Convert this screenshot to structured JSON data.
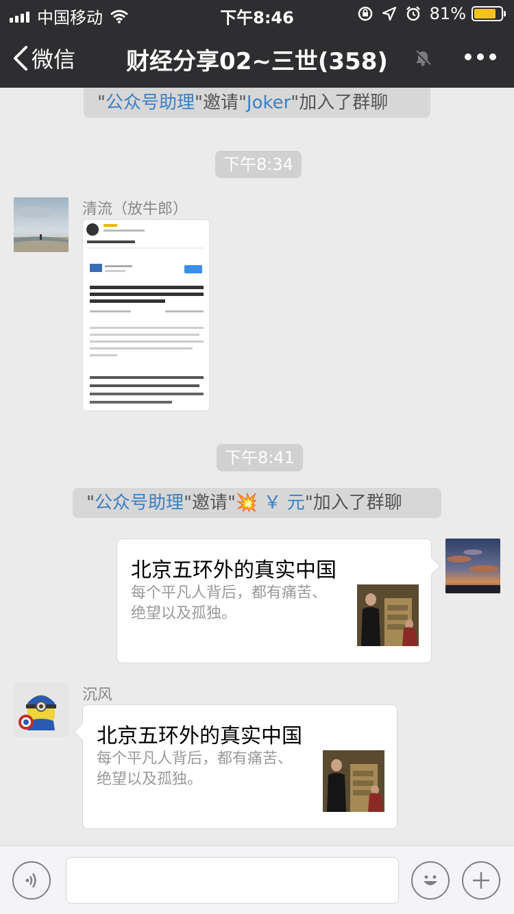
{
  "status_bar": {
    "carrier": "中国移动",
    "time": "下午8:46",
    "battery": "81%",
    "battery_level": 0.81
  },
  "nav": {
    "back_label": "微信",
    "title": "财经分享02~三世(358)"
  },
  "messages": {
    "sys1": {
      "q1": "\"",
      "name1": "公众号助理",
      "q2": "\"邀请\"",
      "name2": "Joker",
      "q3": "\"加入了群聊"
    },
    "time1": "下午8:34",
    "msg1_sender": "清流（放牛郎）",
    "time2": "下午8:41",
    "sys2": {
      "q1": "\"",
      "name1": "公众号助理",
      "q2": "\"邀请\"",
      "emoji": "💥",
      "name2": "￥ 元",
      "q3": "\"加入了群聊"
    },
    "card1": {
      "title": "北京五环外的真实中国",
      "desc": "每个平凡人背后，都有痛苦、绝望以及孤独。"
    },
    "msg3_sender": "沉风",
    "card2": {
      "title": "北京五环外的真实中国",
      "desc": "每个平凡人背后，都有痛苦、绝望以及孤独。"
    }
  },
  "colors": {
    "header_bg": "#2e2e31",
    "chat_bg": "#ebebeb",
    "link_blue": "#3b7fc4",
    "battery_yellow": "#f4c21b"
  },
  "icons": [
    "signal-icon",
    "wifi-icon",
    "lock-rotation-icon",
    "location-arrow-icon",
    "alarm-icon",
    "battery-icon",
    "back-chevron-icon",
    "mute-bell-icon",
    "more-dots-icon",
    "voice-icon",
    "emoji-icon",
    "plus-icon"
  ]
}
